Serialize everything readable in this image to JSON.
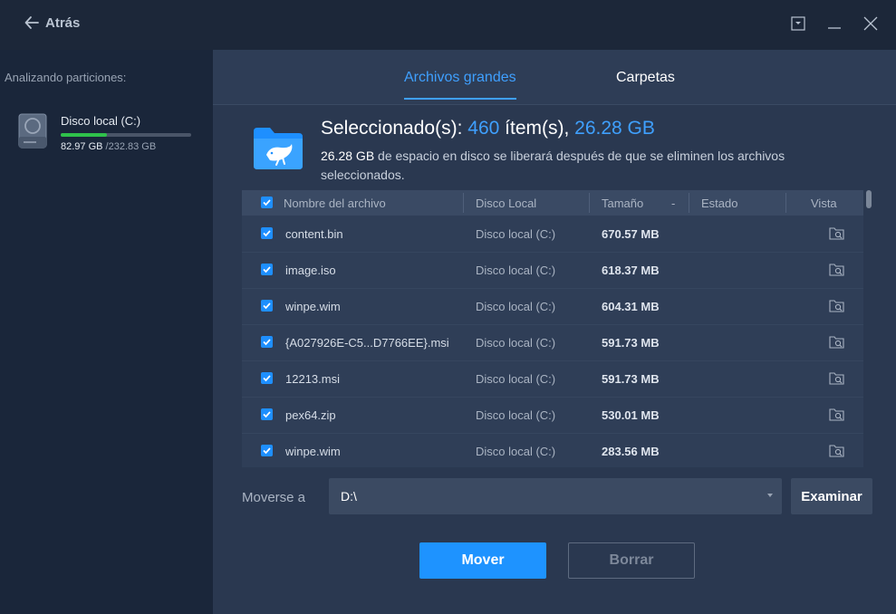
{
  "titlebar": {
    "back_label": "Atrás"
  },
  "sidebar": {
    "label": "Analizando particiones:",
    "drive": {
      "name": "Disco local (C:)",
      "used": "82.97 GB",
      "total": "/232.83 GB",
      "usage_fraction": 0.356,
      "bar_color": "#2fc14b"
    }
  },
  "tabs": [
    {
      "label": "Archivos grandes",
      "active": true
    },
    {
      "label": "Carpetas",
      "active": false
    }
  ],
  "selection": {
    "prefix": "Seleccionado(s):",
    "count": "460",
    "items_label": "ítem(s),",
    "size": "26.28 GB",
    "desc_size": "26.28 GB",
    "desc_rest": "de espacio en disco se liberará después de que se eliminen los archivos seleccionados."
  },
  "table": {
    "columns": {
      "name": "Nombre del archivo",
      "disk": "Disco Local",
      "size": "Tamaño",
      "sort_indicator": "-",
      "state": "Estado",
      "view": "Vista"
    },
    "rows": [
      {
        "name": "content.bin",
        "disk": "Disco local (C:)",
        "size": "670.57 MB",
        "checked": true
      },
      {
        "name": "image.iso",
        "disk": "Disco local (C:)",
        "size": "618.37 MB",
        "checked": true
      },
      {
        "name": "winpe.wim",
        "disk": "Disco local (C:)",
        "size": "604.31 MB",
        "checked": true
      },
      {
        "name": "{A027926E-C5...D7766EE}.msi",
        "disk": "Disco local (C:)",
        "size": "591.73 MB",
        "checked": true
      },
      {
        "name": "12213.msi",
        "disk": "Disco local (C:)",
        "size": "591.73 MB",
        "checked": true
      },
      {
        "name": "pex64.zip",
        "disk": "Disco local (C:)",
        "size": "530.01 MB",
        "checked": true
      },
      {
        "name": "winpe.wim",
        "disk": "Disco local (C:)",
        "size": "283.56 MB",
        "checked": true
      }
    ]
  },
  "move": {
    "label": "Moverse a",
    "path": "D:\\",
    "browse_label": "Examinar"
  },
  "actions": {
    "move_label": "Mover",
    "delete_label": "Borrar"
  },
  "colors": {
    "accent": "#3fa0ff",
    "primary_button": "#1e93ff",
    "checkbox": "#1e8fff"
  },
  "icons": [
    "back-arrow-icon",
    "minimize-to-tray-icon",
    "minimize-icon",
    "close-icon",
    "hard-drive-icon",
    "folder-whale-icon",
    "checkbox-checked-icon",
    "preview-folder-icon",
    "dropdown-arrow-icon"
  ]
}
